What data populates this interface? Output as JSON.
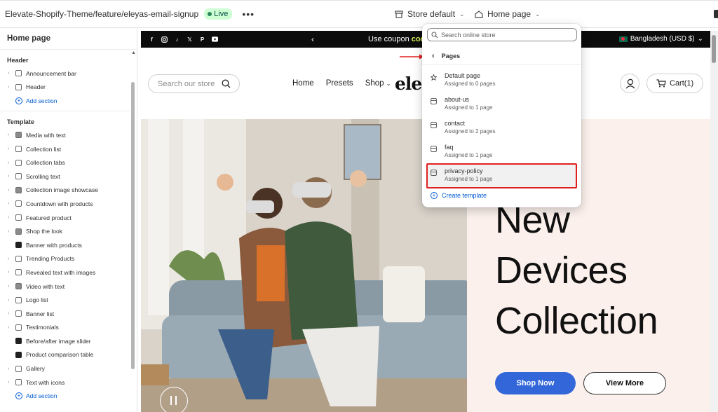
{
  "topbar": {
    "theme_name": "Elevate-Shopify-Theme/feature/eleyas-email-signup",
    "live_label": "Live",
    "more_label": "•••",
    "store_selector": "Store default",
    "page_selector": "Home page"
  },
  "sidebar": {
    "title": "Home page",
    "header_group": "Header",
    "header_items": [
      {
        "label": "Announcement bar",
        "icon": "layout-icon"
      },
      {
        "label": "Header",
        "icon": "layout-icon"
      }
    ],
    "add_section": "Add section",
    "template_group": "Template",
    "template_items": [
      {
        "label": "Media with text",
        "icon": "image-icon"
      },
      {
        "label": "Collection list",
        "icon": "list-icon"
      },
      {
        "label": "Collection tabs",
        "icon": "list-icon"
      },
      {
        "label": "Scrolling text",
        "icon": "text-icon"
      },
      {
        "label": "Collection image showcase",
        "icon": "gear-icon"
      },
      {
        "label": "Countdown with products",
        "icon": "list-icon"
      },
      {
        "label": "Featured product",
        "icon": "list-icon"
      },
      {
        "label": "Shop the look",
        "icon": "image-icon"
      },
      {
        "label": "Banner with products",
        "icon": "banner-icon"
      },
      {
        "label": "Trending Products",
        "icon": "list-icon"
      },
      {
        "label": "Revealed text with images",
        "icon": "list-icon"
      },
      {
        "label": "Video with text",
        "icon": "image-icon"
      },
      {
        "label": "Logo list",
        "icon": "list-icon"
      },
      {
        "label": "Banner list",
        "icon": "list-icon"
      },
      {
        "label": "Testimonials",
        "icon": "list-icon"
      },
      {
        "label": "Before/after image slider",
        "icon": "banner-icon"
      },
      {
        "label": "Product comparison table",
        "icon": "banner-icon"
      },
      {
        "label": "Gallery",
        "icon": "list-icon"
      },
      {
        "label": "Text with icons",
        "icon": "list-icon"
      }
    ],
    "add_section_2": "Add section"
  },
  "store_preview": {
    "announcement_text": "Use coupon ",
    "announcement_code": "code",
    "currency": "Bangladesh (USD $)",
    "search_placeholder": "Search our store",
    "nav": [
      "Home",
      "Presets",
      "Shop"
    ],
    "logo_text": "ele",
    "cart_label": "Cart(1)",
    "hero_title_lines": [
      "New",
      "Devices",
      "Collection"
    ],
    "shop_now": "Shop Now",
    "view_more": "View More"
  },
  "popover": {
    "search_placeholder": "Search online store",
    "back_label": "Pages",
    "items": [
      {
        "name": "Default page",
        "sub": "Assigned to 0 pages",
        "icon": "star-icon"
      },
      {
        "name": "about-us",
        "sub": "Assigned to 1 page",
        "icon": "template-icon"
      },
      {
        "name": "contact",
        "sub": "Assigned to 2 pages",
        "icon": "template-icon"
      },
      {
        "name": "faq",
        "sub": "Assigned to 1 page",
        "icon": "template-icon"
      },
      {
        "name": "privacy-policy",
        "sub": "Assigned to 1 page",
        "icon": "template-icon"
      }
    ],
    "create_template": "Create template"
  },
  "colors": {
    "accent_blue": "#005bd3",
    "live_badge_bg": "#cdfed4",
    "highlight_red": "#e02020",
    "shop_now_blue": "#3367d9"
  }
}
